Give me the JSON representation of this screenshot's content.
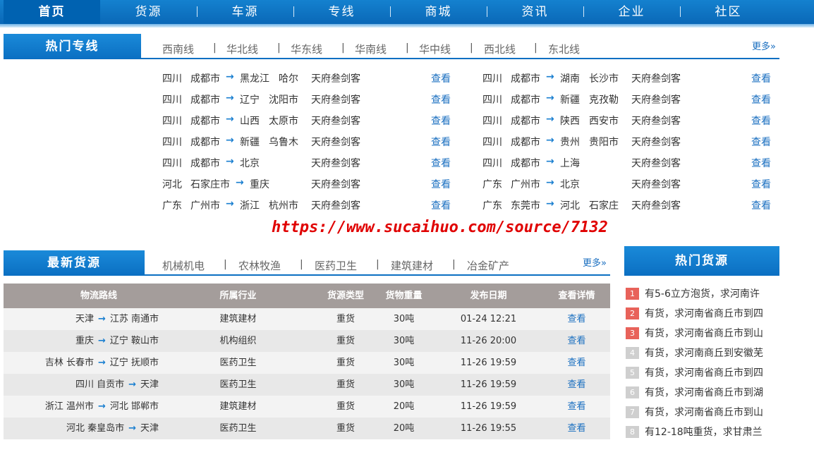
{
  "nav": {
    "items": [
      "首页",
      "货源",
      "车源",
      "专线",
      "商城",
      "资讯",
      "企业",
      "社区"
    ]
  },
  "hot_lines": {
    "title": "热门专线",
    "tabs": [
      "西南线",
      "华北线",
      "华东线",
      "华南线",
      "华中线",
      "西北线",
      "东北线"
    ],
    "more": "更多»",
    "arrow": "→",
    "view_label": "查看",
    "left": [
      {
        "from_prov": "四川",
        "from_city": "成都市",
        "to_prov": "黑龙江",
        "to_city": "哈尔",
        "company": "天府叁剑客"
      },
      {
        "from_prov": "四川",
        "from_city": "成都市",
        "to_prov": "辽宁",
        "to_city": "沈阳市",
        "company": "天府叁剑客"
      },
      {
        "from_prov": "四川",
        "from_city": "成都市",
        "to_prov": "山西",
        "to_city": "太原市",
        "company": "天府叁剑客"
      },
      {
        "from_prov": "四川",
        "from_city": "成都市",
        "to_prov": "新疆",
        "to_city": "乌鲁木",
        "company": "天府叁剑客"
      },
      {
        "from_prov": "四川",
        "from_city": "成都市",
        "to_prov": "北京",
        "to_city": "",
        "company": "天府叁剑客"
      },
      {
        "from_prov": "河北",
        "from_city": "石家庄市",
        "to_prov": "重庆",
        "to_city": "",
        "company": "天府叁剑客"
      },
      {
        "from_prov": "广东",
        "from_city": "广州市",
        "to_prov": "浙江",
        "to_city": "杭州市",
        "company": "天府叁剑客"
      }
    ],
    "right": [
      {
        "from_prov": "四川",
        "from_city": "成都市",
        "to_prov": "湖南",
        "to_city": "长沙市",
        "company": "天府叁剑客"
      },
      {
        "from_prov": "四川",
        "from_city": "成都市",
        "to_prov": "新疆",
        "to_city": "克孜勒",
        "company": "天府叁剑客"
      },
      {
        "from_prov": "四川",
        "from_city": "成都市",
        "to_prov": "陕西",
        "to_city": "西安市",
        "company": "天府叁剑客"
      },
      {
        "from_prov": "四川",
        "from_city": "成都市",
        "to_prov": "贵州",
        "to_city": "贵阳市",
        "company": "天府叁剑客"
      },
      {
        "from_prov": "四川",
        "from_city": "成都市",
        "to_prov": "上海",
        "to_city": "",
        "company": "天府叁剑客"
      },
      {
        "from_prov": "广东",
        "from_city": "广州市",
        "to_prov": "北京",
        "to_city": "",
        "company": "天府叁剑客"
      },
      {
        "from_prov": "广东",
        "from_city": "东莞市",
        "to_prov": "河北",
        "to_city": "石家庄",
        "company": "天府叁剑客"
      }
    ]
  },
  "watermark": "https://www.sucaihuo.com/source/7132",
  "latest_goods": {
    "title": "最新货源",
    "tabs": [
      "机械机电",
      "农林牧渔",
      "医药卫生",
      "建筑建材",
      "冶金矿产"
    ],
    "more": "更多»",
    "columns": [
      "物流路线",
      "所属行业",
      "货源类型",
      "货物重量",
      "发布日期",
      "查看详情"
    ],
    "rows": [
      {
        "from": "天津",
        "to": "江苏 南通市",
        "industry": "建筑建材",
        "type": "重货",
        "weight": "30吨",
        "date": "01-24 12:21",
        "detail": "查看"
      },
      {
        "from": "重庆",
        "to": "辽宁 鞍山市",
        "industry": "机构组织",
        "type": "重货",
        "weight": "30吨",
        "date": "11-26 20:00",
        "detail": "查看"
      },
      {
        "from": "吉林 长春市",
        "to": "辽宁 抚顺市",
        "industry": "医药卫生",
        "type": "重货",
        "weight": "30吨",
        "date": "11-26 19:59",
        "detail": "查看"
      },
      {
        "from": "四川 自贡市",
        "to": "天津",
        "industry": "医药卫生",
        "type": "重货",
        "weight": "30吨",
        "date": "11-26 19:59",
        "detail": "查看"
      },
      {
        "from": "浙江 温州市",
        "to": "河北 邯郸市",
        "industry": "建筑建材",
        "type": "重货",
        "weight": "20吨",
        "date": "11-26 19:59",
        "detail": "查看"
      },
      {
        "from": "河北 秦皇岛市",
        "to": "天津",
        "industry": "医药卫生",
        "type": "重货",
        "weight": "20吨",
        "date": "11-26 19:55",
        "detail": "查看"
      }
    ]
  },
  "hot_goods": {
    "title": "热门货源",
    "items": [
      {
        "num": "1",
        "text": "有5-6立方泡货，求河南许"
      },
      {
        "num": "2",
        "text": "有货，求河南省商丘市到四"
      },
      {
        "num": "3",
        "text": "有货，求河南省商丘市到山"
      },
      {
        "num": "4",
        "text": "有货，求河南商丘到安徽芜"
      },
      {
        "num": "5",
        "text": "有货，求河南省商丘市到四"
      },
      {
        "num": "6",
        "text": "有货，求河南省商丘市到湖"
      },
      {
        "num": "7",
        "text": "有货，求河南省商丘市到山"
      },
      {
        "num": "8",
        "text": "有12-18吨重货，求甘肃兰"
      }
    ]
  },
  "colors": {
    "nav_blue": "#0a68b7",
    "accent_blue": "#1a6fc0",
    "hot_rank": "#e8625a",
    "cold_rank": "#cfcfcf",
    "watermark_red": "#e00000"
  }
}
